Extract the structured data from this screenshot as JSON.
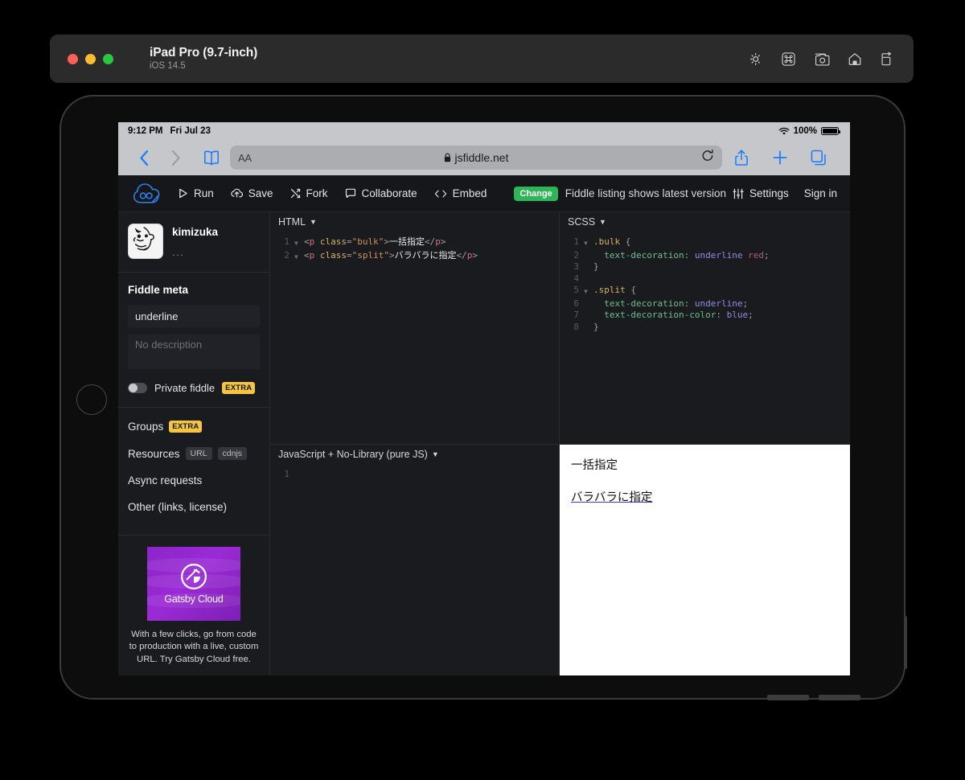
{
  "simulator": {
    "title": "iPad Pro (9.7-inch)",
    "subtitle": "iOS 14.5",
    "tools": [
      "brightness-icon",
      "command-icon",
      "screenshot-icon",
      "home-icon",
      "rotate-icon"
    ]
  },
  "status_bar": {
    "time": "9:12 PM",
    "date": "Fri Jul 23",
    "battery": "100%",
    "wifi_icon": "wifi-icon"
  },
  "safari": {
    "back_icon": "chevron-left-icon",
    "forward_icon": "chevron-right-icon",
    "bookmarks_icon": "book-icon",
    "text_size_label": "AA",
    "lock_icon": "lock-icon",
    "url": "jsfiddle.net",
    "reload_icon": "reload-icon",
    "share_icon": "share-icon",
    "new_tab_icon": "plus-icon",
    "tabs_icon": "tabs-icon"
  },
  "jsfiddle": {
    "logo": "jsfiddle-logo",
    "toolbar": [
      {
        "label": "Run",
        "icon": "play-icon"
      },
      {
        "label": "Save",
        "icon": "cloud-upload-icon"
      },
      {
        "label": "Fork",
        "icon": "fork-icon"
      },
      {
        "label": "Collaborate",
        "icon": "chat-icon"
      },
      {
        "label": "Embed",
        "icon": "code-brackets-icon"
      }
    ],
    "change_badge": "Change",
    "listing_note": "Fiddle listing shows latest version",
    "settings_label": "Settings",
    "settings_icon": "sliders-icon",
    "signin_label": "Sign in",
    "accent_green": "#2fb457",
    "accent_yellow": "#f5c441"
  },
  "sidebar": {
    "user": {
      "name": "kimizuka",
      "avatar": "face-sketch-avatar",
      "more": "..."
    },
    "meta": {
      "title": "Fiddle meta",
      "name_value": "underline",
      "description_placeholder": "No description",
      "private_label": "Private fiddle",
      "private_badge": "EXTRA",
      "private_on": false
    },
    "nav": [
      {
        "label": "Groups",
        "badges": [
          "EXTRA"
        ]
      },
      {
        "label": "Resources",
        "badges": [
          "URL",
          "cdnjs"
        ]
      },
      {
        "label": "Async requests",
        "badges": []
      },
      {
        "label": "Other (links, license)",
        "badges": []
      }
    ],
    "ad": {
      "brand": "Gatsby Cloud",
      "text": "With a few clicks, go from code to production with a live, custom URL. Try Gatsby Cloud free."
    }
  },
  "panes": {
    "html": {
      "title": "HTML",
      "lines": [
        {
          "n": "1",
          "fold": true,
          "tokens": [
            {
              "t": "<",
              "c": "tok-punc"
            },
            {
              "t": "p",
              "c": "tok-tag"
            },
            {
              "t": " ",
              "c": "tok-punc"
            },
            {
              "t": "class",
              "c": "tok-attr"
            },
            {
              "t": "=",
              "c": "tok-punc"
            },
            {
              "t": "\"bulk\"",
              "c": "tok-str"
            },
            {
              "t": ">",
              "c": "tok-punc"
            },
            {
              "t": "一括指定",
              "c": "tok-txt"
            },
            {
              "t": "</",
              "c": "tok-punc"
            },
            {
              "t": "p",
              "c": "tok-tag"
            },
            {
              "t": ">",
              "c": "tok-punc"
            }
          ]
        },
        {
          "n": "2",
          "fold": true,
          "tokens": [
            {
              "t": "<",
              "c": "tok-punc"
            },
            {
              "t": "p",
              "c": "tok-tag"
            },
            {
              "t": " ",
              "c": "tok-punc"
            },
            {
              "t": "class",
              "c": "tok-attr"
            },
            {
              "t": "=",
              "c": "tok-punc"
            },
            {
              "t": "\"split\"",
              "c": "tok-str"
            },
            {
              "t": ">",
              "c": "tok-punc"
            },
            {
              "t": "バラバラに指定",
              "c": "tok-txt"
            },
            {
              "t": "</",
              "c": "tok-punc"
            },
            {
              "t": "p",
              "c": "tok-tag"
            },
            {
              "t": ">",
              "c": "tok-punc"
            }
          ]
        }
      ]
    },
    "scss": {
      "title": "SCSS",
      "lines": [
        {
          "n": "1",
          "fold": true,
          "tokens": [
            {
              "t": ".bulk",
              "c": "tok-sel"
            },
            {
              "t": " {",
              "c": "tok-punc"
            }
          ]
        },
        {
          "n": "2",
          "fold": false,
          "tokens": [
            {
              "t": "  text-decoration",
              "c": "tok-prop"
            },
            {
              "t": ": ",
              "c": "tok-punc"
            },
            {
              "t": "underline",
              "c": "tok-val"
            },
            {
              "t": " ",
              "c": "tok-punc"
            },
            {
              "t": "red",
              "c": "tok-red"
            },
            {
              "t": ";",
              "c": "tok-punc"
            }
          ]
        },
        {
          "n": "3",
          "fold": false,
          "tokens": [
            {
              "t": "}",
              "c": "tok-punc"
            }
          ]
        },
        {
          "n": "4",
          "fold": false,
          "tokens": [
            {
              "t": "",
              "c": "tok-punc"
            }
          ]
        },
        {
          "n": "5",
          "fold": true,
          "tokens": [
            {
              "t": ".split",
              "c": "tok-sel"
            },
            {
              "t": " {",
              "c": "tok-punc"
            }
          ]
        },
        {
          "n": "6",
          "fold": false,
          "tokens": [
            {
              "t": "  text-decoration",
              "c": "tok-prop"
            },
            {
              "t": ": ",
              "c": "tok-punc"
            },
            {
              "t": "underline",
              "c": "tok-val"
            },
            {
              "t": ";",
              "c": "tok-punc"
            }
          ]
        },
        {
          "n": "7",
          "fold": false,
          "tokens": [
            {
              "t": "  text-decoration-color",
              "c": "tok-prop"
            },
            {
              "t": ": ",
              "c": "tok-punc"
            },
            {
              "t": "blue",
              "c": "tok-val"
            },
            {
              "t": ";",
              "c": "tok-punc"
            }
          ]
        },
        {
          "n": "8",
          "fold": false,
          "tokens": [
            {
              "t": "}",
              "c": "tok-punc"
            }
          ]
        }
      ]
    },
    "js": {
      "title": "JavaScript + No-Library (pure JS)",
      "lines": [
        {
          "n": "1",
          "fold": false,
          "tokens": [
            {
              "t": "",
              "c": "tok-punc"
            }
          ]
        }
      ]
    },
    "result": {
      "bulk_text": "一括指定",
      "split_text": "バラバラに指定",
      "split_underline_color": "#3a3ad0"
    }
  }
}
